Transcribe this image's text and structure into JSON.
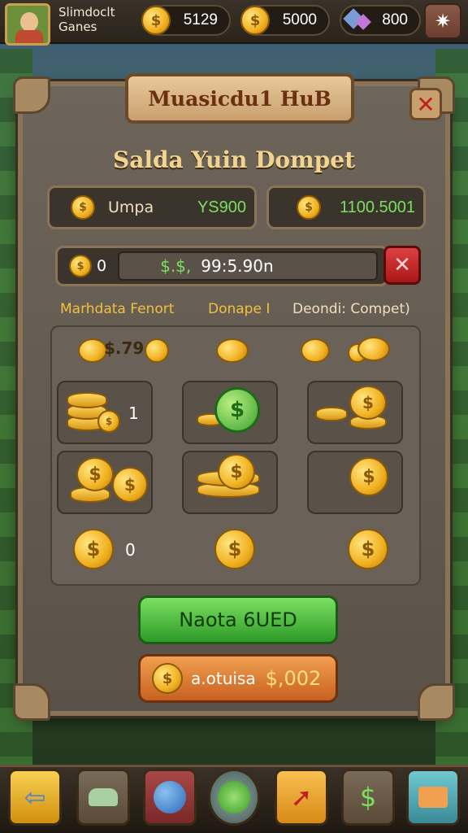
{
  "topbar": {
    "brand_line1": "Slimdoclt",
    "brand_line2": "Ganes",
    "resource1": "5129",
    "resource2": "5000",
    "resource3": "800"
  },
  "panel": {
    "title": "Muasicdu1 HuB",
    "subtitle": "Salda Yuin Dompet",
    "stat_left_label": "Umpa",
    "stat_left_value": "YS900",
    "stat_right_value": "1100.5001",
    "bar_left": "0",
    "bar_field_prefix": "$.$,",
    "bar_field_value": "99:5.90n",
    "col1": "Marhdata Fenort",
    "col2": "Donape I",
    "col3": "Deondi: Compet)",
    "cell_a": "$.79",
    "cell_b": "1",
    "cell_c": "0",
    "btn_green": "Naota 6UED",
    "btn_orange_a": "a.otuisa",
    "btn_orange_b": "$,002"
  },
  "icons": {
    "coin": "$",
    "close": "✕",
    "settings": "✷",
    "back": "⇦",
    "dollar": "$"
  },
  "colors": {
    "accent_gold": "#f2c040",
    "green": "#7ae060",
    "panel_bg": "#6e655a"
  }
}
